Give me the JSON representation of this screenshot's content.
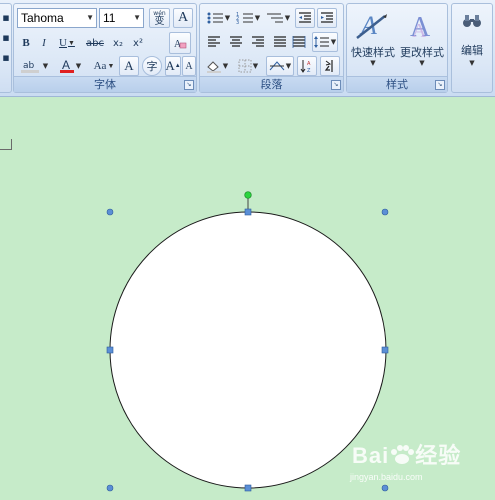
{
  "font": {
    "family_value": "Tahoma",
    "size_value": "11",
    "group_label": "字体",
    "bold": "B",
    "italic": "I",
    "underline": "U",
    "strike": "abc",
    "subscript": "x₂",
    "superscript": "x²",
    "char_case": "Aa",
    "grow": "A",
    "shrink": "A",
    "phonetic_top": "wén",
    "phonetic_bottom": "变",
    "char_border": "A",
    "char_shade": "A",
    "enclose": "字"
  },
  "paragraph": {
    "group_label": "段落"
  },
  "styles": {
    "group_label": "样式",
    "quick_styles": "快速样式",
    "change_styles": "更改样式"
  },
  "editing": {
    "label": "编辑"
  },
  "colors": {
    "ribbon": "#d6e4f5",
    "canvas": "#c6ebc9",
    "handle_blue": "#5b8fd6",
    "handle_green": "#2bd43e",
    "font_red": "#e02020"
  },
  "watermark": {
    "brand": "Bai",
    "brand2": "经验",
    "url": "jingyan.baidu.com"
  }
}
